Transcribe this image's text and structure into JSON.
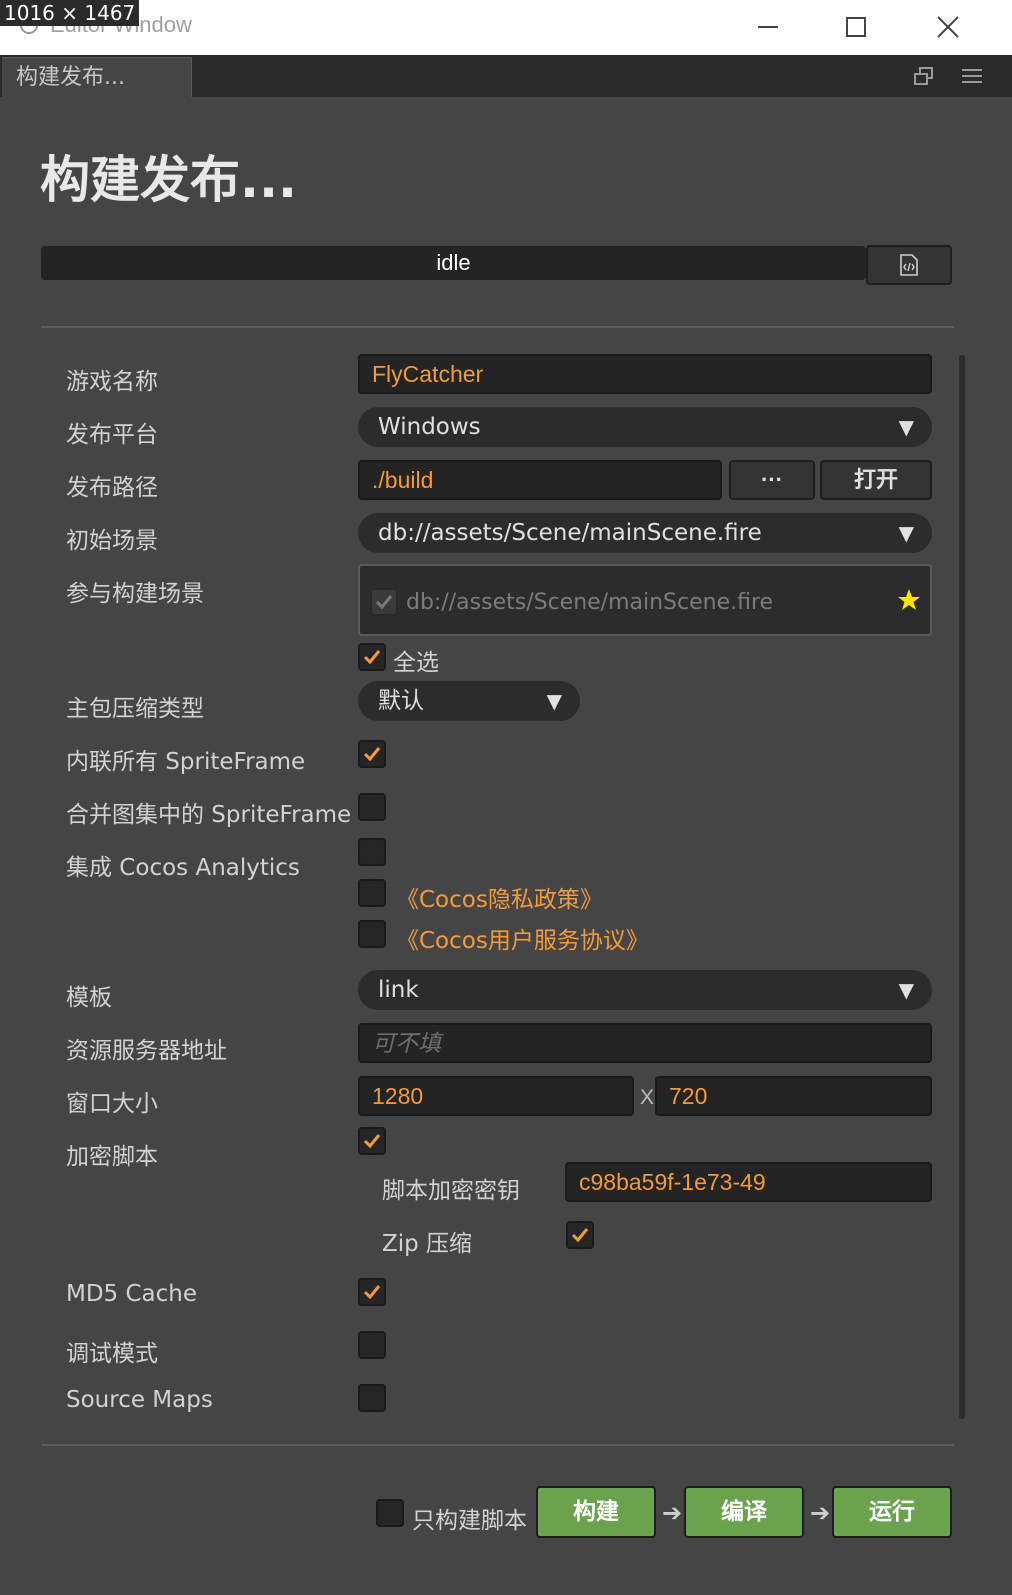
{
  "window": {
    "size_badge": "1016 × 1467",
    "title": "Editor Window",
    "controls": {
      "minimize": "—",
      "maximize": "☐",
      "close": "✕"
    }
  },
  "tab": {
    "label": "构建发布..."
  },
  "page": {
    "heading": "构建发布..."
  },
  "status": {
    "text": "idle"
  },
  "form": {
    "game_name": {
      "label": "游戏名称",
      "value": "FlyCatcher"
    },
    "platform": {
      "label": "发布平台",
      "value": "Windows"
    },
    "build_path": {
      "label": "发布路径",
      "value": "./build",
      "browse_label": "···",
      "open_label": "打开"
    },
    "start_scene": {
      "label": "初始场景",
      "value": "db://assets/Scene/mainScene.fire"
    },
    "scenes": {
      "label": "参与构建场景",
      "item": "db://assets/Scene/mainScene.fire",
      "select_all": "全选"
    },
    "compression": {
      "label": "主包压缩类型",
      "value": "默认"
    },
    "inline_sprite": {
      "label": "内联所有 SpriteFrame",
      "checked": true
    },
    "merge_sprite": {
      "label": "合并图集中的 SpriteFrame",
      "checked": false
    },
    "analytics": {
      "label": "集成 Cocos Analytics",
      "checked": false,
      "privacy": "《Cocos隐私政策》",
      "agreement": "《Cocos用户服务协议》"
    },
    "template": {
      "label": "模板",
      "value": "link"
    },
    "resource_server": {
      "label": "资源服务器地址",
      "placeholder": "可不填"
    },
    "window_size": {
      "label": "窗口大小",
      "width": "1280",
      "separator": "X",
      "height": "720"
    },
    "encrypt": {
      "label": "加密脚本",
      "checked": true,
      "key_label": "脚本加密密钥",
      "key_value": "c98ba59f-1e73-49",
      "zip_label": "Zip 压缩"
    },
    "md5": {
      "label": "MD5 Cache",
      "checked": true
    },
    "debug": {
      "label": "调试模式",
      "checked": false
    },
    "source_maps": {
      "label": "Source Maps",
      "checked": false
    }
  },
  "footer": {
    "script_only": "只构建脚本",
    "build": "构建",
    "compile": "编译",
    "run": "运行"
  },
  "colors": {
    "accent": "#f39a3a",
    "green": "#6aa24e",
    "star": "#ffe500"
  }
}
